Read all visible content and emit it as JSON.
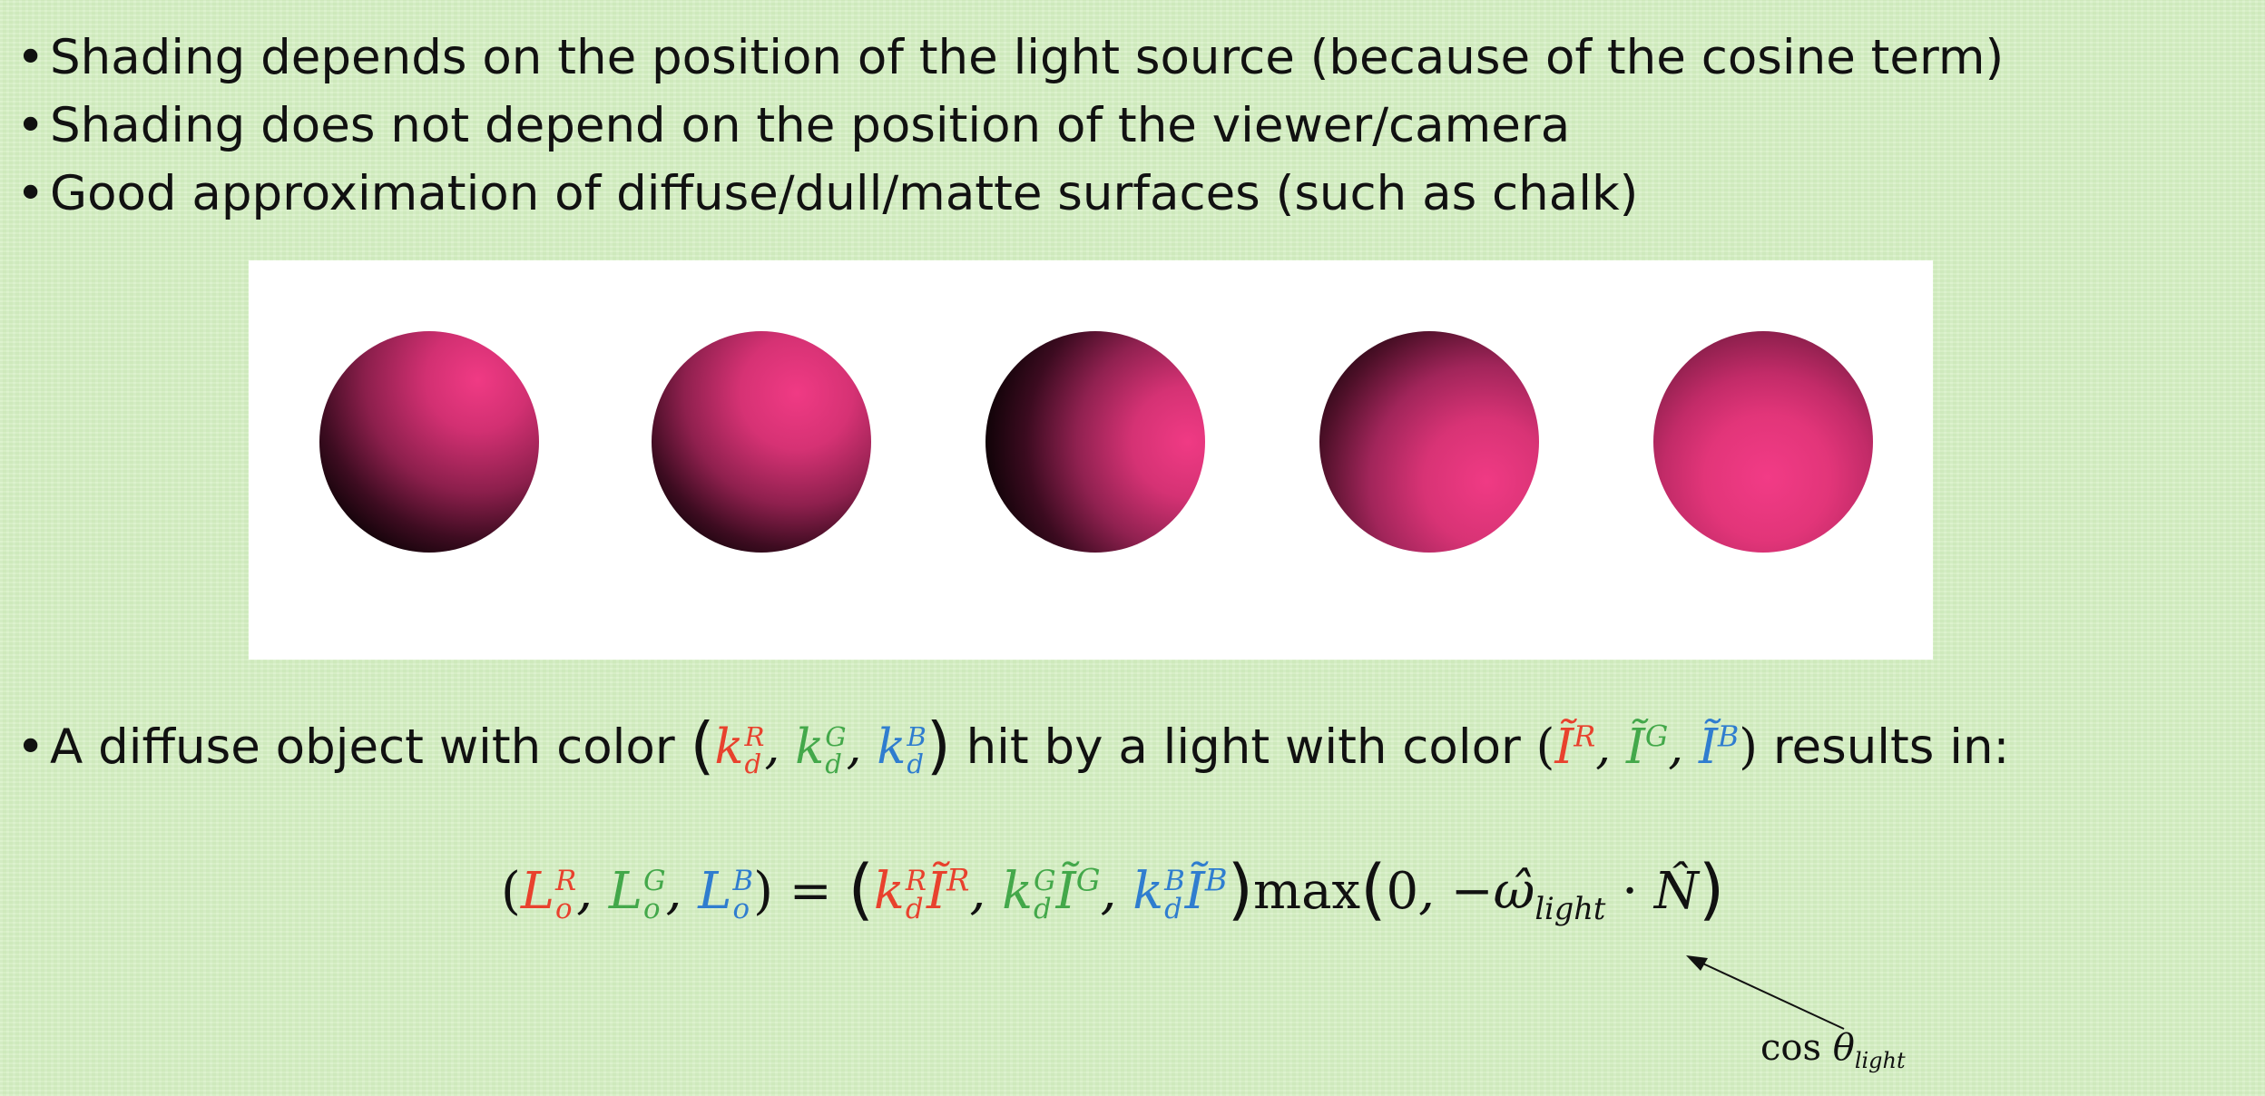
{
  "bullets": [
    "Shading depends on the position of the light source (because of the cosine term)",
    "Shading does not depend on the position of the viewer/camera",
    "Good approximation of diffuse/dull/matte surfaces (such as chalk)"
  ],
  "bullet_symbol": "•",
  "spheres": [
    "light-upper-right",
    "light-upper-right-center",
    "light-right",
    "light-lower-right",
    "light-front"
  ],
  "diffuse_sentence": {
    "prefix": "A diffuse object with color",
    "middle": "hit by a light with color",
    "suffix": "results in:"
  },
  "symbols": {
    "k": "k",
    "d": "d",
    "I_tilde": "Ĩ",
    "L": "L",
    "o": "o",
    "R": "R",
    "G": "G",
    "B": "B",
    "max": "max",
    "zero": "0",
    "omega_hat": "−ω̂",
    "light": "light",
    "dot": "·",
    "N_hat": "N̂",
    "equals": "=",
    "cos": "cos",
    "theta": "θ"
  },
  "colors": {
    "red": "#e8412d",
    "green": "#43a84a",
    "blue": "#2f7dcf",
    "sphere_pink": "#f03a84"
  }
}
